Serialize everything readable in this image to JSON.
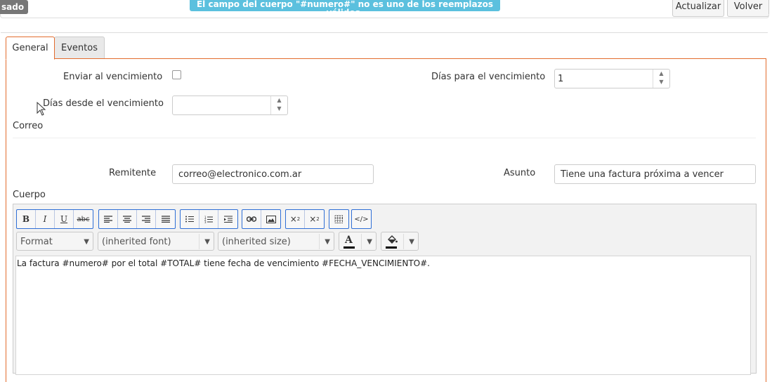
{
  "header": {
    "status_badge": "sado",
    "error_message": "El campo del cuerpo \"#numero#\" no es uno de los reemplazos válidos.",
    "update_button": "Actualizar",
    "back_button": "Volver"
  },
  "tabs": [
    {
      "label": "General",
      "active": true
    },
    {
      "label": "Eventos",
      "active": false
    }
  ],
  "form": {
    "send_on_due_label": "Enviar al vencimiento",
    "send_on_due_checked": false,
    "days_to_due_label": "Días para el vencimiento",
    "days_to_due_value": "1",
    "days_since_due_label": "Días desde el vencimiento",
    "days_since_due_value": "",
    "mail_section": "Correo",
    "sender_label": "Remitente",
    "sender_value": "correo@electronico.com.ar",
    "subject_label": "Asunto",
    "subject_value": "Tiene una factura próxima a vencer",
    "body_label": "Cuerpo"
  },
  "editor": {
    "format_label": "Format",
    "font_label": "(inherited font)",
    "size_label": "(inherited size)",
    "body_text": "La factura #numero# por el total #TOTAL# tiene fecha de vencimiento #FECHA_VENCIMIENTO#."
  },
  "colors": {
    "accent": "#e36c2d",
    "info": "#5bc0de",
    "toolbar_border": "#2f6fd6"
  }
}
